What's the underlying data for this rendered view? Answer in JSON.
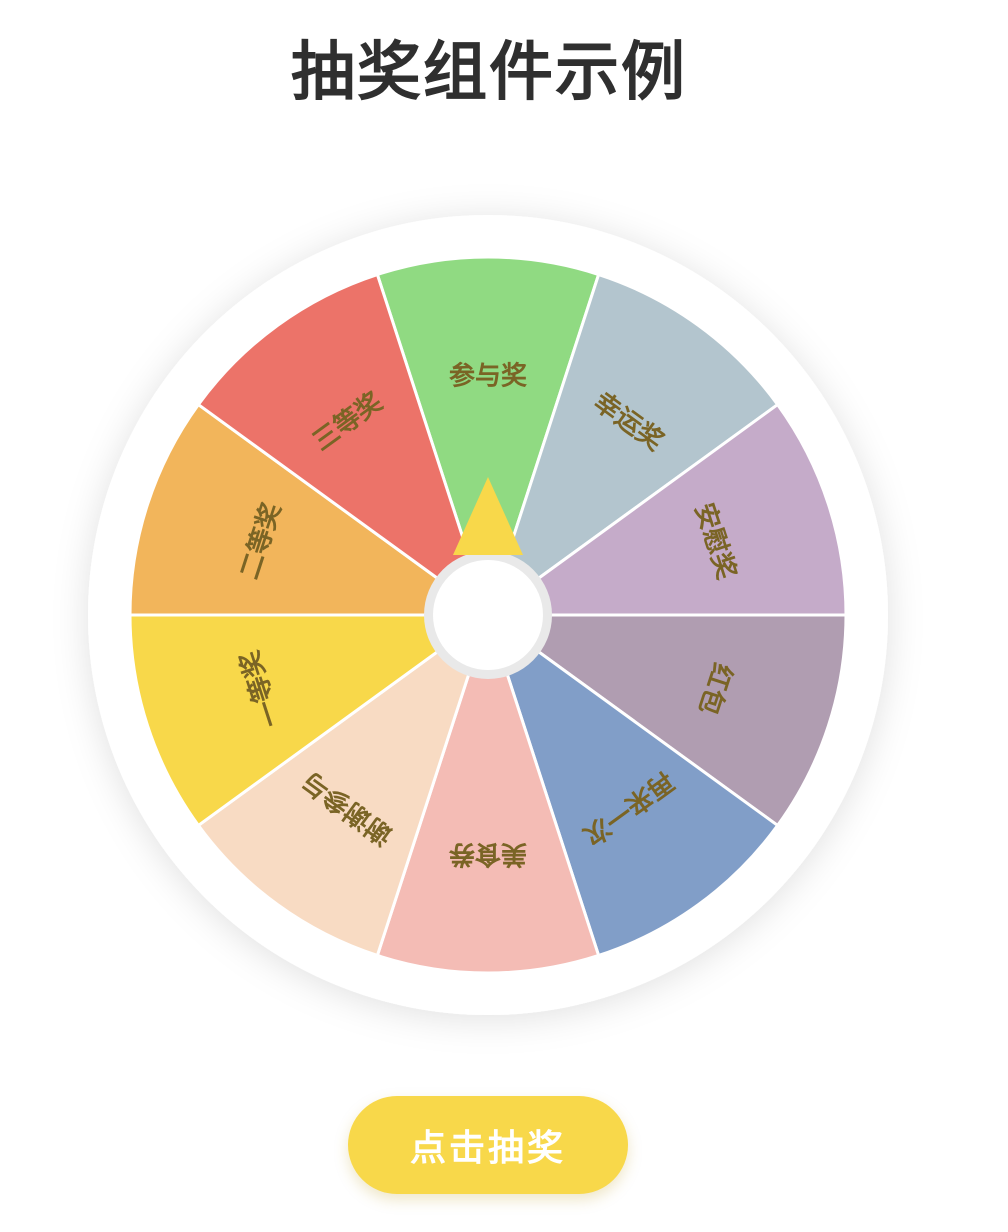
{
  "page": {
    "title": "抽奖组件示例"
  },
  "wheel": {
    "segments": [
      {
        "label": "参与奖",
        "color": "#90da82"
      },
      {
        "label": "幸运奖",
        "color": "#b3c5ce"
      },
      {
        "label": "安慰奖",
        "color": "#c5abc9"
      },
      {
        "label": "红包",
        "color": "#b09db1"
      },
      {
        "label": "再来一次",
        "color": "#819ec8"
      },
      {
        "label": "美食券",
        "color": "#f4bcb5"
      },
      {
        "label": "谢谢参与",
        "color": "#f8dbc3"
      },
      {
        "label": "一等奖",
        "color": "#f8d84a"
      },
      {
        "label": "二等奖",
        "color": "#f2b55b"
      },
      {
        "label": "三等奖",
        "color": "#ec7369"
      }
    ],
    "rim_color": "#ffffff",
    "hub_color": "#ffffff",
    "hub_ring_color": "#e8e8e8",
    "pointer_color": "#f8d84a",
    "pointer_icon": "triangle-pointer-icon",
    "label_color": "#7a6425"
  },
  "action": {
    "spin_label": "点击抽奖"
  }
}
